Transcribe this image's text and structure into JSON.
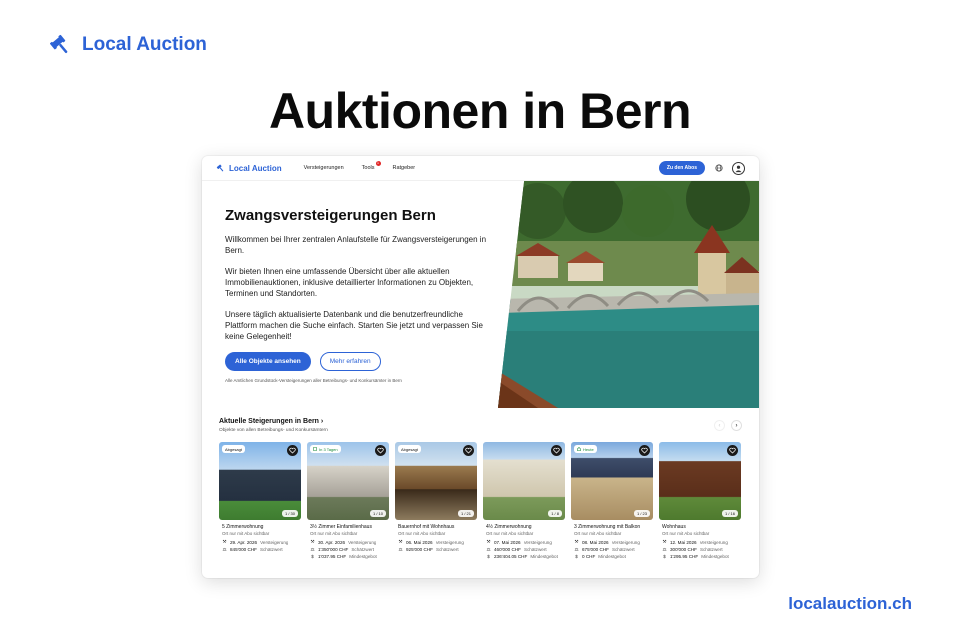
{
  "brand": {
    "name": "Local Auction"
  },
  "hero_title": "Auktionen in Bern",
  "footer_url": "localauction.ch",
  "colors": {
    "brand_blue": "#2d63d6",
    "badge_red": "#e02424",
    "badge_green": "#1b8a3a"
  },
  "site": {
    "nav": {
      "logo": "Local Auction",
      "links": [
        "Versteigerungen",
        "Tools",
        "Ratgeber"
      ],
      "tools_badge": "1",
      "cta": "Zu den Abos",
      "icons": [
        "globe-icon",
        "user-icon"
      ]
    },
    "hero": {
      "title": "Zwangsversteigerungen Bern",
      "p1": "Willkommen bei Ihrer zentralen Anlaufstelle für Zwangsversteigerungen in Bern.",
      "p2": "Wir bieten Ihnen eine umfassende Übersicht über alle aktuellen Immobilienauktionen, inklusive detaillierter Informationen zu Objekten, Terminen und Standorten.",
      "p3": "Unsere täglich aktualisierte Datenbank und die benutzerfreundliche Plattform machen die Suche einfach. Starten Sie jetzt und verpassen Sie keine Gelegenheit!",
      "btn_primary": "Alle Objekte ansehen",
      "btn_secondary": "Mehr erfahren",
      "note": "Alle Amtlichen Grundstück-Versteigerungen aller Betreibungs- und Konkursämter in Bern"
    },
    "section": {
      "title": "Aktuelle Steigerungen in Bern ›",
      "subtitle": "Objekte von allen Betreibungs- und Konkursämtern",
      "prev": "‹",
      "next": "›"
    },
    "cards": [
      {
        "badge": "Abgesagt",
        "count": "1 / 30",
        "title": "5 Zimmerwohnung",
        "sub": "Ort nur mit Abo sichtbar",
        "date": "29. Apr. 2026",
        "date_label": "Versteigerung",
        "price": "845'000 CHF",
        "price_label": "Schätzwert",
        "extra": "",
        "extra_label": ""
      },
      {
        "badge": "In 3 Tagen",
        "count": "1 / 10",
        "title": "3½ Zimmer Einfamilienhaus",
        "sub": "Ort nur mit Abo sichtbar",
        "date": "30. Apr. 2026",
        "date_label": "Versteigerung",
        "price": "1'350'000 CHF",
        "price_label": "Schätzwert",
        "extra": "1'037.95 CHF",
        "extra_label": "Mindestgebot"
      },
      {
        "badge": "Abgesagt",
        "count": "1 / 21",
        "title": "Bauernhof mit Wohnhaus",
        "sub": "Ort nur mit Abo sichtbar",
        "date": "06. Mai 2026",
        "date_label": "Versteigerung",
        "price": "925'000 CHF",
        "price_label": "Schätzwert",
        "extra": "",
        "extra_label": ""
      },
      {
        "badge": "",
        "count": "1 / 8",
        "title": "4½ Zimmerwohnung",
        "sub": "Ort nur mit Abo sichtbar",
        "date": "07. Mai 2026",
        "date_label": "Versteigerung",
        "price": "460'000 CHF",
        "price_label": "Schätzwert",
        "extra": "236'404.05 CHF",
        "extra_label": "Mindestgebot"
      },
      {
        "badge": "Heute",
        "count": "1 / 23",
        "title": "3 Zimmerwohnung mit Balkon",
        "sub": "Ort nur mit Abo sichtbar",
        "date": "08. Mai 2026",
        "date_label": "Versteigerung",
        "price": "675'000 CHF",
        "price_label": "Schätzwert",
        "extra": "0 CHF",
        "extra_label": "Mindestgebot"
      },
      {
        "badge": "",
        "count": "1 / 16",
        "title": "Wohnhaus",
        "sub": "Ort nur mit Abo sichtbar",
        "date": "12. Mai 2026",
        "date_label": "Versteigerung",
        "price": "300'000 CHF",
        "price_label": "Schätzwert",
        "extra": "1'295.95 CHF",
        "extra_label": "Mindestgebot"
      }
    ]
  }
}
